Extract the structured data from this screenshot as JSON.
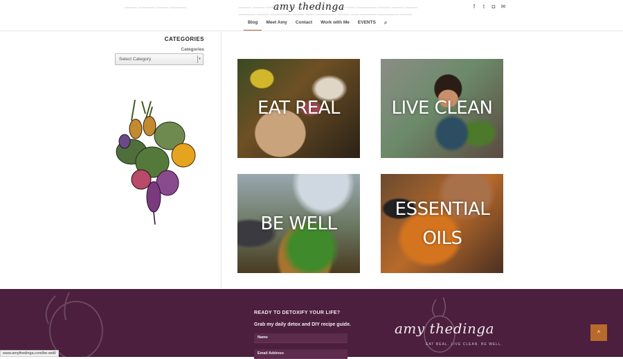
{
  "header": {
    "logo_text": "amy thedinga",
    "nav": [
      {
        "label": "Blog",
        "active": true
      },
      {
        "label": "Meet Amy",
        "active": false
      },
      {
        "label": "Contact",
        "active": false
      },
      {
        "label": "Work with Me",
        "active": false
      },
      {
        "label": "EVENTS",
        "active": false
      }
    ],
    "social_icons": [
      "facebook-icon",
      "twitter-icon",
      "instagram-icon",
      "email-icon"
    ],
    "accent": "#b85d2e"
  },
  "sidebar": {
    "title": "CATEGORIES",
    "label": "Categories",
    "select_value": "Select Category"
  },
  "tiles": [
    {
      "label": "EAT REAL"
    },
    {
      "label": "LIVE CLEAN"
    },
    {
      "label": "BE WELL"
    },
    {
      "label": "ESSENTIAL OILS"
    }
  ],
  "footer": {
    "title": "READY TO DETOXIFY YOUR LIFE?",
    "subtitle": "Grab my daily detox and DIY recipe guide.",
    "name_placeholder": "Name",
    "email_placeholder": "Email Address",
    "logo_text": "amy thedinga",
    "tagline": "EAT REAL. LIVE CLEAN. BE WELL.",
    "bg_color": "#4b1f3d",
    "to_top_color": "#b76a2b"
  },
  "status_bar": {
    "url": "www.amythedinga.com/be-well/"
  }
}
